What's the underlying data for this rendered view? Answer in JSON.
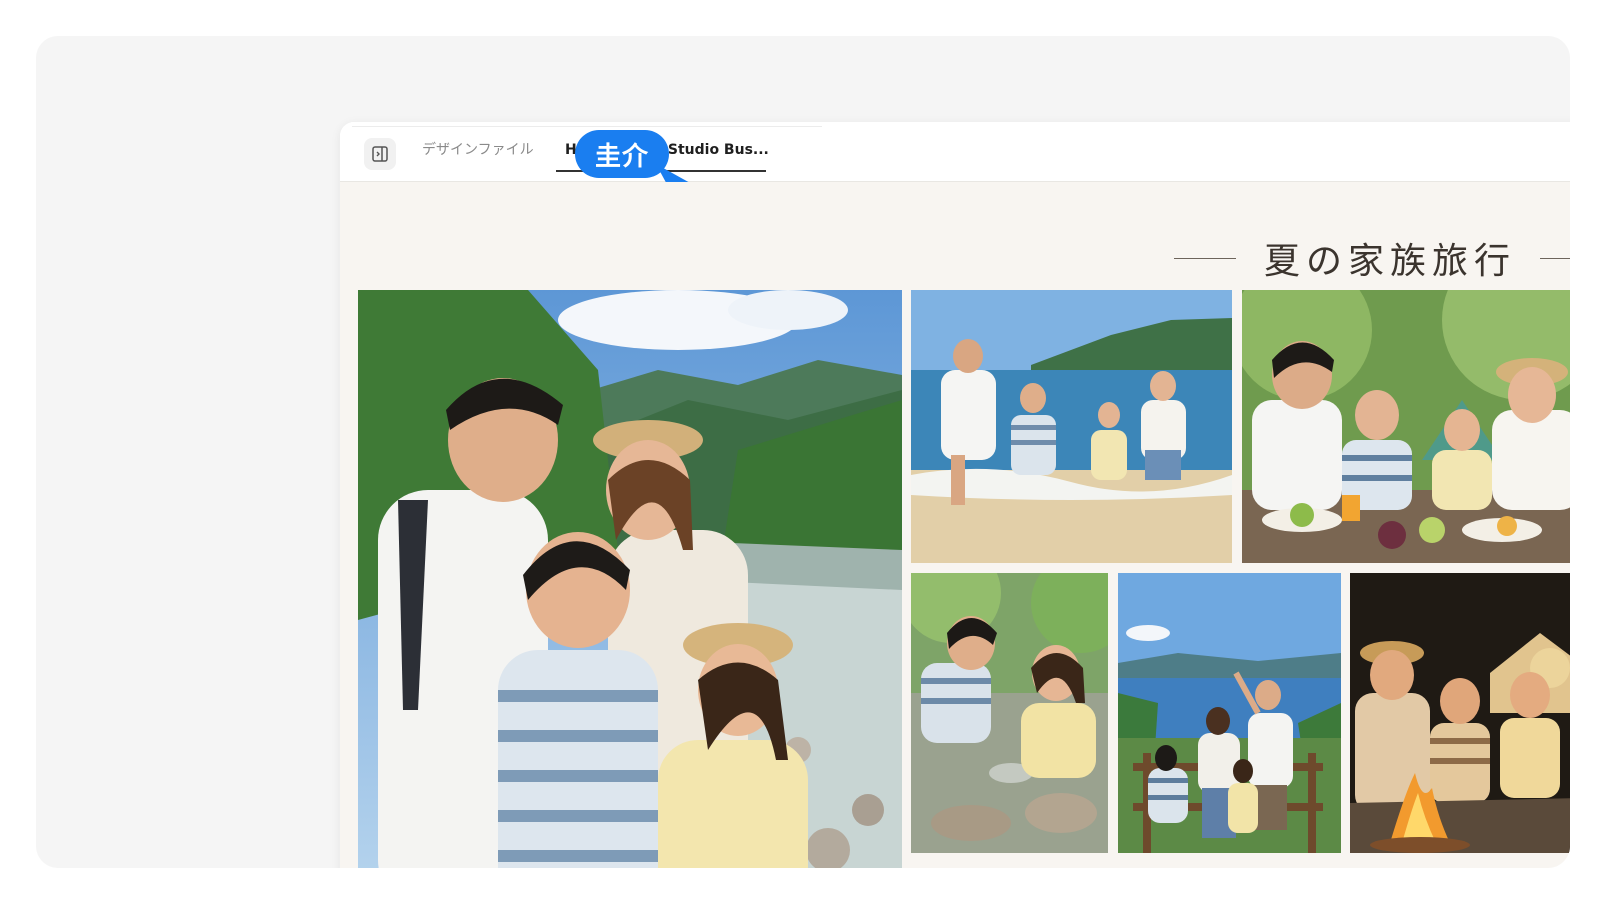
{
  "tabs": [
    {
      "label": "デザインファイル",
      "active": false
    },
    {
      "label": "Hikari Photo Studio Bus...",
      "active": true
    }
  ],
  "collaborator_cursor": {
    "name": "圭介",
    "color": "#1a7ef0"
  },
  "album": {
    "title": "夏の家族旅行"
  },
  "photos": [
    {
      "scene": "family-mountain-river"
    },
    {
      "scene": "family-beach"
    },
    {
      "scene": "family-picnic"
    },
    {
      "scene": "kids-river-rocks"
    },
    {
      "scene": "family-lake-view"
    },
    {
      "scene": "family-campfire"
    }
  ],
  "colors": {
    "canvas_background": "#f8f5f1",
    "cursor_blue": "#1a7ef0",
    "title_text": "#3b342e"
  }
}
